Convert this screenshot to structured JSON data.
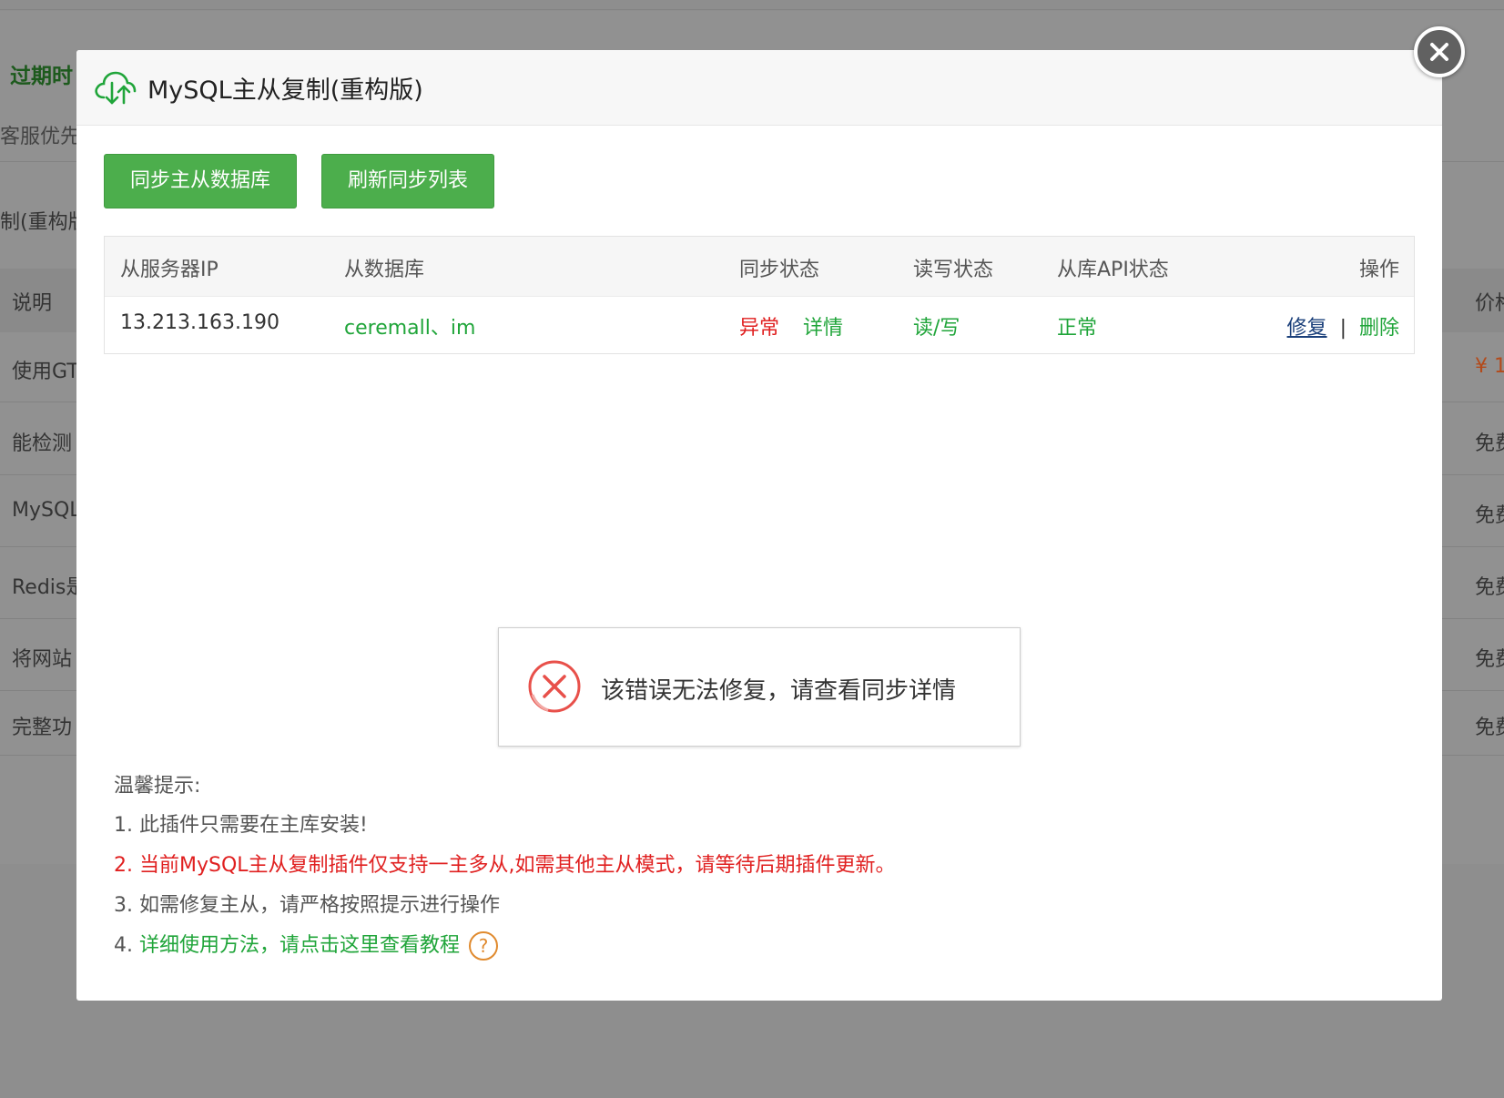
{
  "background": {
    "expire_label": "过期时",
    "service_label": "客服优先",
    "plugin_title_fragment": "制(重构版",
    "header_left": "说明",
    "header_right": "价格",
    "rows": [
      {
        "left": "使用GT",
        "right": "¥ 1"
      },
      {
        "left": "能检测",
        "right": "免费"
      },
      {
        "left": "MySQL",
        "right": "免费"
      },
      {
        "left": "Redis是",
        "right": "免费"
      },
      {
        "left": "将网站",
        "right": "免费"
      },
      {
        "left": "完整功",
        "right": "免费"
      }
    ]
  },
  "modal": {
    "title": "MySQL主从复制(重构版)",
    "title_icon": "cloud-sync-icon",
    "close_icon": "close-icon",
    "buttons": {
      "sync": "同步主从数据库",
      "refresh": "刷新同步列表"
    },
    "table": {
      "headers": [
        "从服务器IP",
        "从数据库",
        "同步状态",
        "读写状态",
        "从库API状态",
        "操作"
      ],
      "rows": [
        {
          "ip": "13.213.163.190",
          "databases": "ceremall、im",
          "sync_status": "异常",
          "sync_detail": "详情",
          "rw_status": "读/写",
          "api_status": "正常",
          "op_repair": "修复",
          "op_separator": "|",
          "op_delete": "删除"
        }
      ]
    },
    "toast": {
      "icon": "error-x-icon",
      "message": "该错误无法修复，请查看同步详情"
    },
    "tips": {
      "title": "温馨提示:",
      "items": [
        "1. 此插件只需要在主库安装!",
        "2. 当前MySQL主从复制插件仅支持一主多从,如需其他主从模式，请等待后期插件更新。",
        "3. 如需修复主从，请严格按照提示进行操作"
      ],
      "item4_prefix": "4. ",
      "item4_link": "详细使用方法，请点击这里查看教程",
      "help_glyph": "?"
    }
  },
  "colors": {
    "primary_green": "#20a53a",
    "button_green": "#4cae4c",
    "error_red": "#e02020",
    "help_orange": "#e08a2e",
    "overlay_gray": "#8e8e8e"
  }
}
